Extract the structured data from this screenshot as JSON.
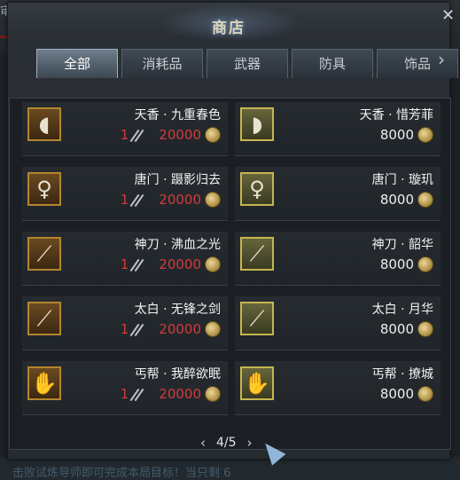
{
  "window": {
    "title": "商店",
    "close_label": "✕"
  },
  "background": {
    "corner_text": "审",
    "bottom_text": "击败试炼导师即可完成本局目标！当只剩 6"
  },
  "tabs": [
    {
      "label": "全部"
    },
    {
      "label": "消耗品"
    },
    {
      "label": "武器"
    },
    {
      "label": "防具"
    },
    {
      "label": "饰品"
    }
  ],
  "tab_next_label": "›",
  "items_left": [
    {
      "name": "天香 · 九重春色",
      "count": "1",
      "price": "20000"
    },
    {
      "name": "唐门 · 蹑影归去",
      "count": "1",
      "price": "20000"
    },
    {
      "name": "神刀 · 沸血之光",
      "count": "1",
      "price": "20000"
    },
    {
      "name": "太白 · 无锋之剑",
      "count": "1",
      "price": "20000"
    },
    {
      "name": "丐帮 · 我醉欲眠",
      "count": "1",
      "price": "20000"
    }
  ],
  "items_right": [
    {
      "name": "天香 · 惜芳菲",
      "price": "8000"
    },
    {
      "name": "唐门 · 璇玑",
      "price": "8000"
    },
    {
      "name": "神刀 · 韶华",
      "price": "8000"
    },
    {
      "name": "太白 · 月华",
      "price": "8000"
    },
    {
      "name": "丐帮 · 撩城",
      "price": "8000"
    }
  ],
  "pager": {
    "prev": "‹",
    "page": "4/5",
    "next": "›"
  },
  "icons": [
    "fan-icon",
    "doll-icon",
    "blade-icon",
    "sword-icon",
    "gauntlet-icon"
  ],
  "colors": {
    "price_red": "#d23b3b",
    "title_glow": "#6d8fb8"
  }
}
